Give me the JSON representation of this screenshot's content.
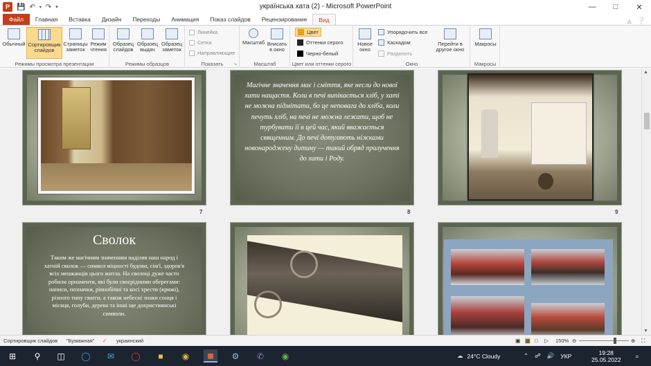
{
  "window": {
    "title": "українська хата (2)  -  Microsoft PowerPoint"
  },
  "tabs": [
    "Файл",
    "Главная",
    "Вставка",
    "Дизайн",
    "Переходы",
    "Анимация",
    "Показ слайдов",
    "Рецензирование",
    "Вид"
  ],
  "ribbon": {
    "views": {
      "label": "Режимы просмотра презентации",
      "buttons": [
        "Обычный",
        "Сортировщик слайдов",
        "Страницы заметок",
        "Режим чтения"
      ]
    },
    "masters": {
      "label": "Режимы образцов",
      "buttons": [
        "Образец слайдов",
        "Образец выдач",
        "Образец заметок"
      ]
    },
    "show": {
      "label": "Показать",
      "items": [
        "Линейка",
        "Сетка",
        "Направляющие"
      ]
    },
    "zoom": {
      "label": "Масштаб",
      "buttons": [
        "Масштаб",
        "Вписать в окно"
      ]
    },
    "color": {
      "label": "Цвет или оттенки серого",
      "items": [
        "Цвет",
        "Оттенки серого",
        "Черно-белый"
      ]
    },
    "window": {
      "label": "Окно",
      "new_window": "Новое окно",
      "items": [
        "Упорядочить все",
        "Каскадом",
        "Разделить"
      ],
      "switch": "Перейти в другое окно"
    },
    "macros": {
      "label": "Макросы",
      "button": "Макросы"
    }
  },
  "slides": {
    "s7": {
      "num": "7"
    },
    "s8": {
      "num": "8",
      "text": "Магічне значення має і сміття, яке несли до нової хати нащастя. Коли в печі випікається хліб, у хаті не можна підмітати, бо це неповага до хліба, коли печуть хліб, на печі не можна лежати, щоб не турбувати її в цей час, який вважається священним. До печі дотуляють ніжками новонароджену дитину — такий обряд прилучення до хати і Роду."
    },
    "s9": {
      "num": "9"
    },
    "s10": {
      "title": "Сволок",
      "body": "Таким же магічним значенням наділяв наш народ і хатній сволок — символ міцності будови, сім'ї, здоров'я всіх мешканців цього житла. На сволоці дуже часто робили орнаменти, які були своєрідними оберегами: написи, позначки, рівнобічні та косі хрести (крижі), різного типу свarги, а також небесні знаки сонця і місяця, голуби, дерева та інші ще дохристиянські символи."
    }
  },
  "status": {
    "view": "Сортировщик слайдов",
    "theme": "\"Бумажная\"",
    "language": "украинский",
    "zoom": "150%"
  },
  "taskbar": {
    "weather": "24°C  Cloudy",
    "lang": "УКР",
    "time": "19:28",
    "date": "25.05.2022"
  }
}
